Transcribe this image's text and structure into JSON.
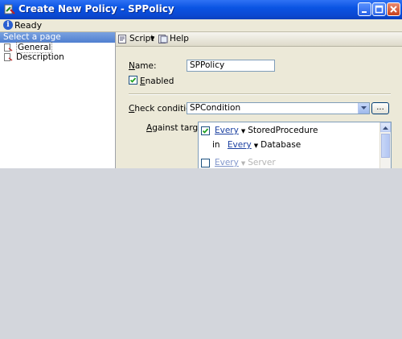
{
  "window": {
    "title": "Create New Policy - SPPolicy"
  },
  "status": {
    "text": "Ready"
  },
  "sidebar": {
    "header": "Select a page",
    "items": [
      {
        "label": "General",
        "selected": true
      },
      {
        "label": "Description",
        "selected": false
      }
    ]
  },
  "toolbar": {
    "script_label": "Script",
    "help_label": "Help"
  },
  "form": {
    "name_label_u": "N",
    "name_label_rest": "ame:",
    "name_value": "SPPolicy",
    "enabled_label_u": "E",
    "enabled_label_rest": "nabled",
    "enabled_checked": true,
    "check_condition_label_u": "C",
    "check_condition_label_rest": "heck condition:",
    "check_condition_value": "SPCondition",
    "ellipsis_label": "...",
    "against_targets_label_u": "A",
    "against_targets_label_rest": "gainst targets:",
    "targets": [
      {
        "checked": true,
        "link": "Every",
        "object": "StoredProcedure"
      },
      {
        "prefix": "in",
        "link": "Every",
        "object": "Database"
      },
      {
        "checked": false,
        "link": "Every",
        "object": "Server"
      }
    ]
  },
  "colors": {
    "title_bar": "#0a54e3",
    "link": "#1a3fa0",
    "dialog_bg": "#ece9d8",
    "desktop_bg": "#d3d6dc"
  }
}
